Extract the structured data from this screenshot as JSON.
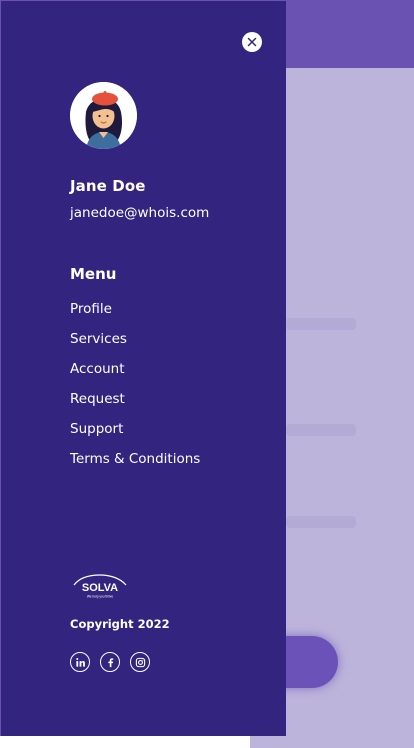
{
  "drawer": {
    "user": {
      "name": "Jane Doe",
      "email": "janedoe@whois.com"
    },
    "menu": {
      "title": "Menu",
      "items": [
        {
          "label": "Profile"
        },
        {
          "label": "Services"
        },
        {
          "label": "Account"
        },
        {
          "label": "Request"
        },
        {
          "label": "Support"
        },
        {
          "label": "Terms & Conditions"
        }
      ]
    },
    "footer": {
      "logo_text": "SOLVA",
      "logo_tagline": "We help you thrive",
      "copyright": "Copyright 2022",
      "social_icons": [
        "linkedin-icon",
        "facebook-icon",
        "instagram-icon"
      ]
    }
  },
  "colors": {
    "drawer_bg": "#33247f",
    "backdrop": "#6a52b3",
    "text": "#ffffff"
  }
}
